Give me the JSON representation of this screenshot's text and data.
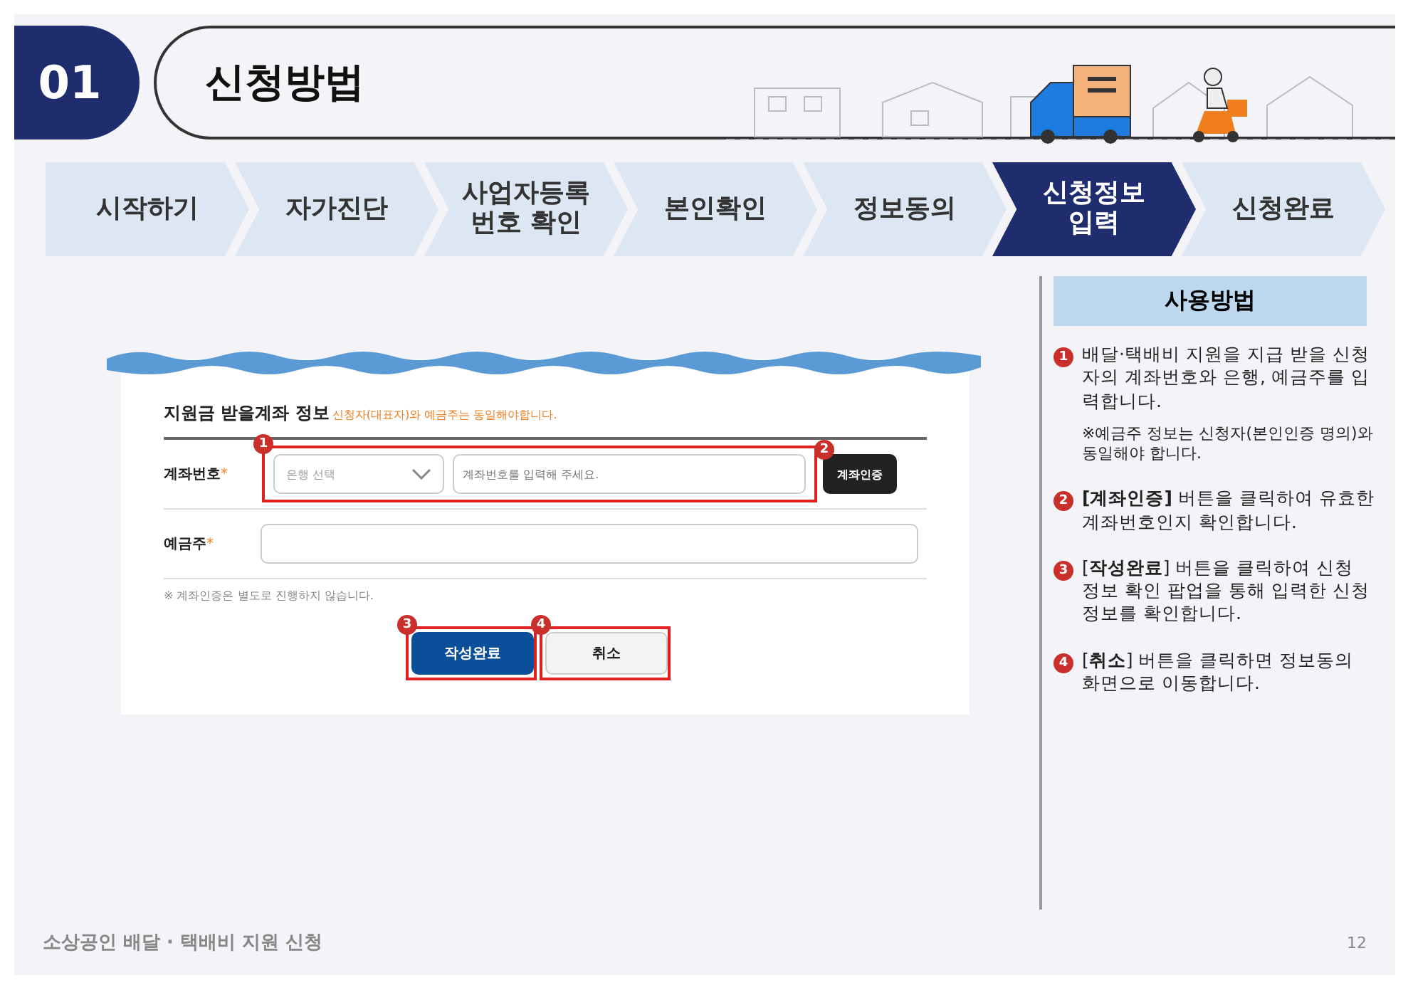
{
  "header": {
    "number": "01",
    "title": "신청방법"
  },
  "steps": [
    {
      "label": "시작하기",
      "selected": false
    },
    {
      "label": "자가진단",
      "selected": false
    },
    {
      "label": "사업자등록\n번호 확인",
      "selected": false
    },
    {
      "label": "본인확인",
      "selected": false
    },
    {
      "label": "정보동의",
      "selected": false
    },
    {
      "label": "신청정보\n입력",
      "selected": true
    },
    {
      "label": "신청완료",
      "selected": false
    }
  ],
  "form": {
    "heading": "지원금 받을계좌 정보",
    "heading_note": "신청자(대표자)와 예금주는 동일해야합니다.",
    "account": {
      "label": "계좌번호",
      "required_mark": "*",
      "bank_placeholder": "은행 선택",
      "number_placeholder": "계좌번호를 입력해 주세요.",
      "verify_button": "계좌인증",
      "group_marker": "1",
      "verify_marker": "2"
    },
    "holder": {
      "label": "예금주",
      "required_mark": "*"
    },
    "notice": "※ 계좌인증은 별도로 진행하지 않습니다.",
    "buttons": [
      {
        "label": "작성완료",
        "kind": "primary",
        "marker": "3"
      },
      {
        "label": "취소",
        "kind": "secondary",
        "marker": "4"
      }
    ]
  },
  "guide": {
    "title": "사용방법",
    "items": [
      {
        "number": "1",
        "text": "배달·택배비 지원을 지급 받을 신청자의 계좌번호와 은행, 예금주를 입력합니다.",
        "note": "※예금주 정보는 신청자(본인인증 명의)와 동일해야 합니다."
      },
      {
        "number": "2",
        "text": "**[계좌인증]** 버튼을 클릭하여 유효한 계좌번호인지 확인합니다."
      },
      {
        "number": "3",
        "text": "[**작성완료**] 버튼을 클릭하여 신청 정보 확인 팝업을 통해 입력한 신청정보를 확인합니다."
      },
      {
        "number": "4",
        "text": "[**취소**] 버튼을 클릭하면 정보동의 화면으로 이동합니다."
      }
    ]
  },
  "footer": {
    "title": "소상공인 배달 · 택배비 지원 신청",
    "page": "12"
  }
}
